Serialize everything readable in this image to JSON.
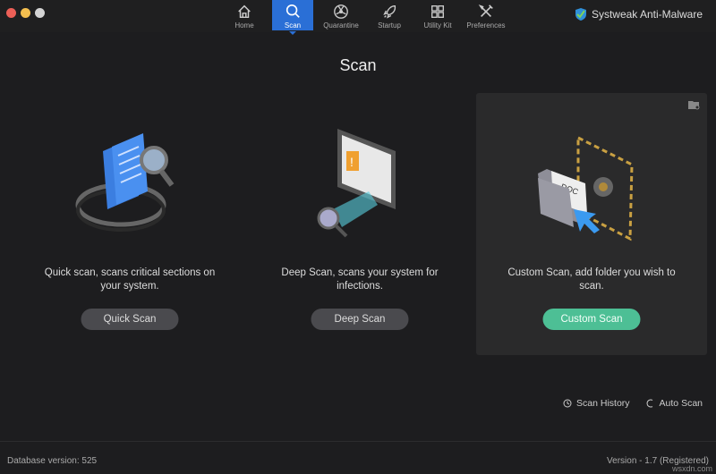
{
  "window": {
    "traffic_lights": [
      "#ec5f57",
      "#f4bf4f",
      "#d4d4d4"
    ]
  },
  "nav": {
    "items": [
      {
        "label": "Home",
        "icon": "home-icon"
      },
      {
        "label": "Scan",
        "icon": "search-icon",
        "active": true
      },
      {
        "label": "Quarantine",
        "icon": "radiation-icon"
      },
      {
        "label": "Startup",
        "icon": "rocket-icon"
      },
      {
        "label": "Utility Kit",
        "icon": "grid-icon"
      },
      {
        "label": "Preferences",
        "icon": "tools-icon"
      }
    ]
  },
  "brand": {
    "name": "Systweak Anti-Malware"
  },
  "page": {
    "title": "Scan"
  },
  "cards": [
    {
      "desc": "Quick scan, scans critical sections on your system.",
      "button": "Quick Scan"
    },
    {
      "desc": "Deep Scan, scans your system for infections.",
      "button": "Deep Scan"
    },
    {
      "desc": "Custom Scan, add folder you wish to scan.",
      "button": "Custom Scan",
      "doc_label": "DOC"
    }
  ],
  "links": {
    "history": "Scan History",
    "auto": "Auto Scan"
  },
  "footer": {
    "db": "Database version: 525",
    "version": "Version  -  1.7 (Registered)"
  },
  "watermark": "wsxdn.com",
  "colors": {
    "accent": "#2a6fd6",
    "green": "#4dbf95"
  }
}
